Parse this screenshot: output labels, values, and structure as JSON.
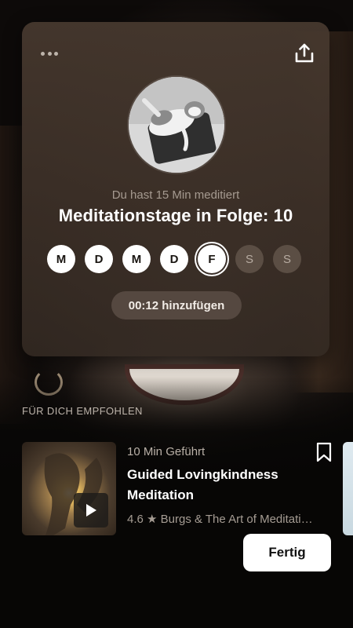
{
  "header": {
    "more_icon": "more-horizontal-icon",
    "share_icon": "share-upload-icon"
  },
  "summary": {
    "subtitle": "Du hast 15 Min meditiert",
    "title": "Meditationstage in Folge: 10",
    "days": [
      {
        "label": "M",
        "state": "done"
      },
      {
        "label": "D",
        "state": "done"
      },
      {
        "label": "M",
        "state": "done"
      },
      {
        "label": "D",
        "state": "done"
      },
      {
        "label": "F",
        "state": "today"
      },
      {
        "label": "S",
        "state": "future"
      },
      {
        "label": "S",
        "state": "future"
      }
    ],
    "add_button": "00:12 hinzufügen"
  },
  "recommended": {
    "section_label": "FÜR DICH EMPFOHLEN",
    "item": {
      "meta": "10 Min Geführt",
      "title": "Guided Lovingkindness Meditation",
      "subtitle": "4.6 ★ Burgs & The Art of Meditati…",
      "play_icon": "play-icon",
      "bookmark_icon": "bookmark-icon"
    }
  },
  "footer": {
    "done_button": "Fertig"
  },
  "colors": {
    "card_bg": "#463a30",
    "accent_white": "#ffffff",
    "muted_text": "#a59a90"
  }
}
